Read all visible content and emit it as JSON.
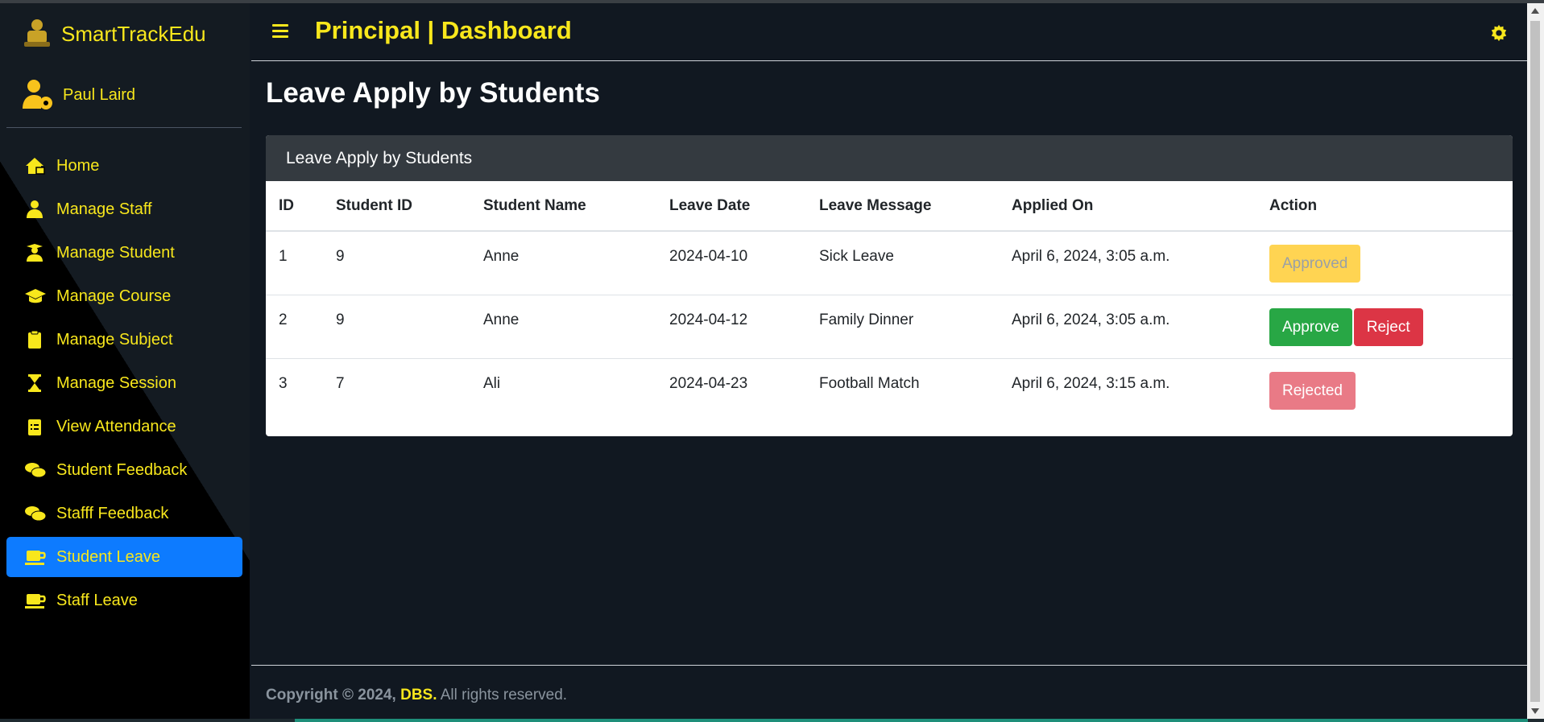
{
  "sidebar": {
    "brand": "SmartTrackEdu",
    "user": "Paul Laird",
    "items": [
      {
        "label": "Home",
        "icon": "home-icon"
      },
      {
        "label": "Manage Staff",
        "icon": "user-tie-icon"
      },
      {
        "label": "Manage Student",
        "icon": "user-graduate-icon"
      },
      {
        "label": "Manage Course",
        "icon": "graduation-cap-icon"
      },
      {
        "label": "Manage Subject",
        "icon": "clipboard-icon"
      },
      {
        "label": "Manage Session",
        "icon": "hourglass-icon"
      },
      {
        "label": "View Attendance",
        "icon": "clipboard-list-icon"
      },
      {
        "label": "Student Feedback",
        "icon": "comments-icon"
      },
      {
        "label": "Stafff Feedback",
        "icon": "comments-icon"
      },
      {
        "label": "Student Leave",
        "icon": "mug-icon",
        "active": true
      },
      {
        "label": "Staff Leave",
        "icon": "mug-icon"
      }
    ]
  },
  "header": {
    "title": "Principal | Dashboard"
  },
  "main": {
    "page_title": "Leave Apply by Students",
    "card_title": "Leave Apply by Students",
    "columns": [
      "ID",
      "Student ID",
      "Student Name",
      "Leave Date",
      "Leave Message",
      "Applied On",
      "Action"
    ],
    "rows": [
      {
        "id": "1",
        "student_id": "9",
        "name": "Anne",
        "date": "2024-04-10",
        "message": "Sick Leave",
        "applied": "April 6, 2024, 3:05 a.m.",
        "status": "Approved"
      },
      {
        "id": "2",
        "student_id": "9",
        "name": "Anne",
        "date": "2024-04-12",
        "message": "Family Dinner",
        "applied": "April 6, 2024, 3:05 a.m.",
        "approve_label": "Approve",
        "reject_label": "Reject"
      },
      {
        "id": "3",
        "student_id": "7",
        "name": "Ali",
        "date": "2024-04-23",
        "message": "Football Match",
        "applied": "April 6, 2024, 3:15 a.m.",
        "status": "Rejected"
      }
    ]
  },
  "footer": {
    "copyright": "Copyright © 2024,",
    "brand": "DBS.",
    "rights": "All rights reserved."
  },
  "colors": {
    "accent": "#f8e71c",
    "active_nav": "#0d7bff",
    "approved": "#ffd452",
    "approve": "#28a745",
    "reject": "#dc3545",
    "rejected": "#e97a86"
  }
}
